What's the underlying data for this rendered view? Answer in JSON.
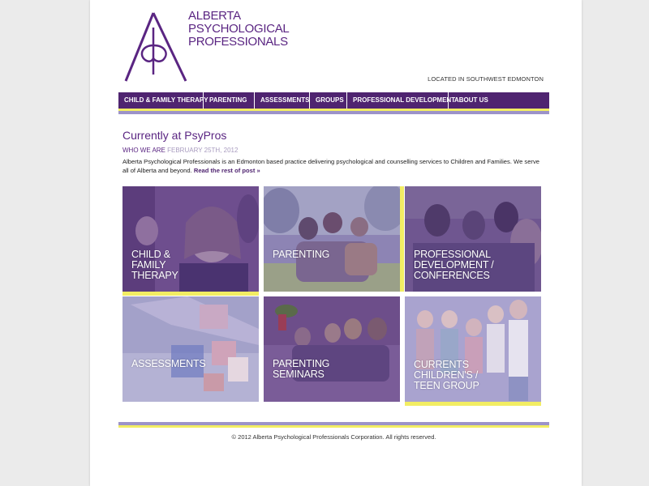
{
  "logo": {
    "line1": "ALBERTA",
    "line2": "PSYCHOLOGICAL",
    "line3": "PROFESSIONALS"
  },
  "location": "LOCATED IN SOUTHWEST EDMONTON",
  "nav": {
    "items": [
      {
        "label": "CHILD & FAMILY THERAPY"
      },
      {
        "label": "PARENTING"
      },
      {
        "label": "ASSESSMENTS"
      },
      {
        "label": "GROUPS"
      },
      {
        "label": "PROFESSIONAL DEVELOPMENT"
      },
      {
        "label": "ABOUT US"
      }
    ]
  },
  "post": {
    "heading": "Currently at PsyPros",
    "category": "WHO WE ARE",
    "date": "FEBRUARY 25TH, 2012",
    "body": "Alberta Psychological Professionals is an Edmonton based practice delivering psychological and counselling services to Children and Families. We serve all of Alberta and beyond.",
    "read_more": "Read the rest of post »"
  },
  "tiles": [
    {
      "lines": [
        "CHILD &",
        "FAMILY",
        "THERAPY"
      ]
    },
    {
      "lines": [
        "PARENTING"
      ]
    },
    {
      "lines": [
        "PROFESSIONAL",
        "DEVELOPMENT /",
        "CONFERENCES"
      ]
    },
    {
      "lines": [
        "ASSESSMENTS"
      ]
    },
    {
      "lines": [
        "PARENTING",
        "SEMINARS"
      ]
    },
    {
      "lines": [
        "CURRENTS",
        "CHILDREN'S /",
        "TEEN GROUP"
      ]
    }
  ],
  "footer": {
    "copyright": "© 2012 Alberta Psychological Professionals Corporation. All rights reserved."
  },
  "colors": {
    "brand_purple": "#4f2470",
    "accent_yellow": "#f2ed63",
    "lavender": "#9c93c9"
  }
}
